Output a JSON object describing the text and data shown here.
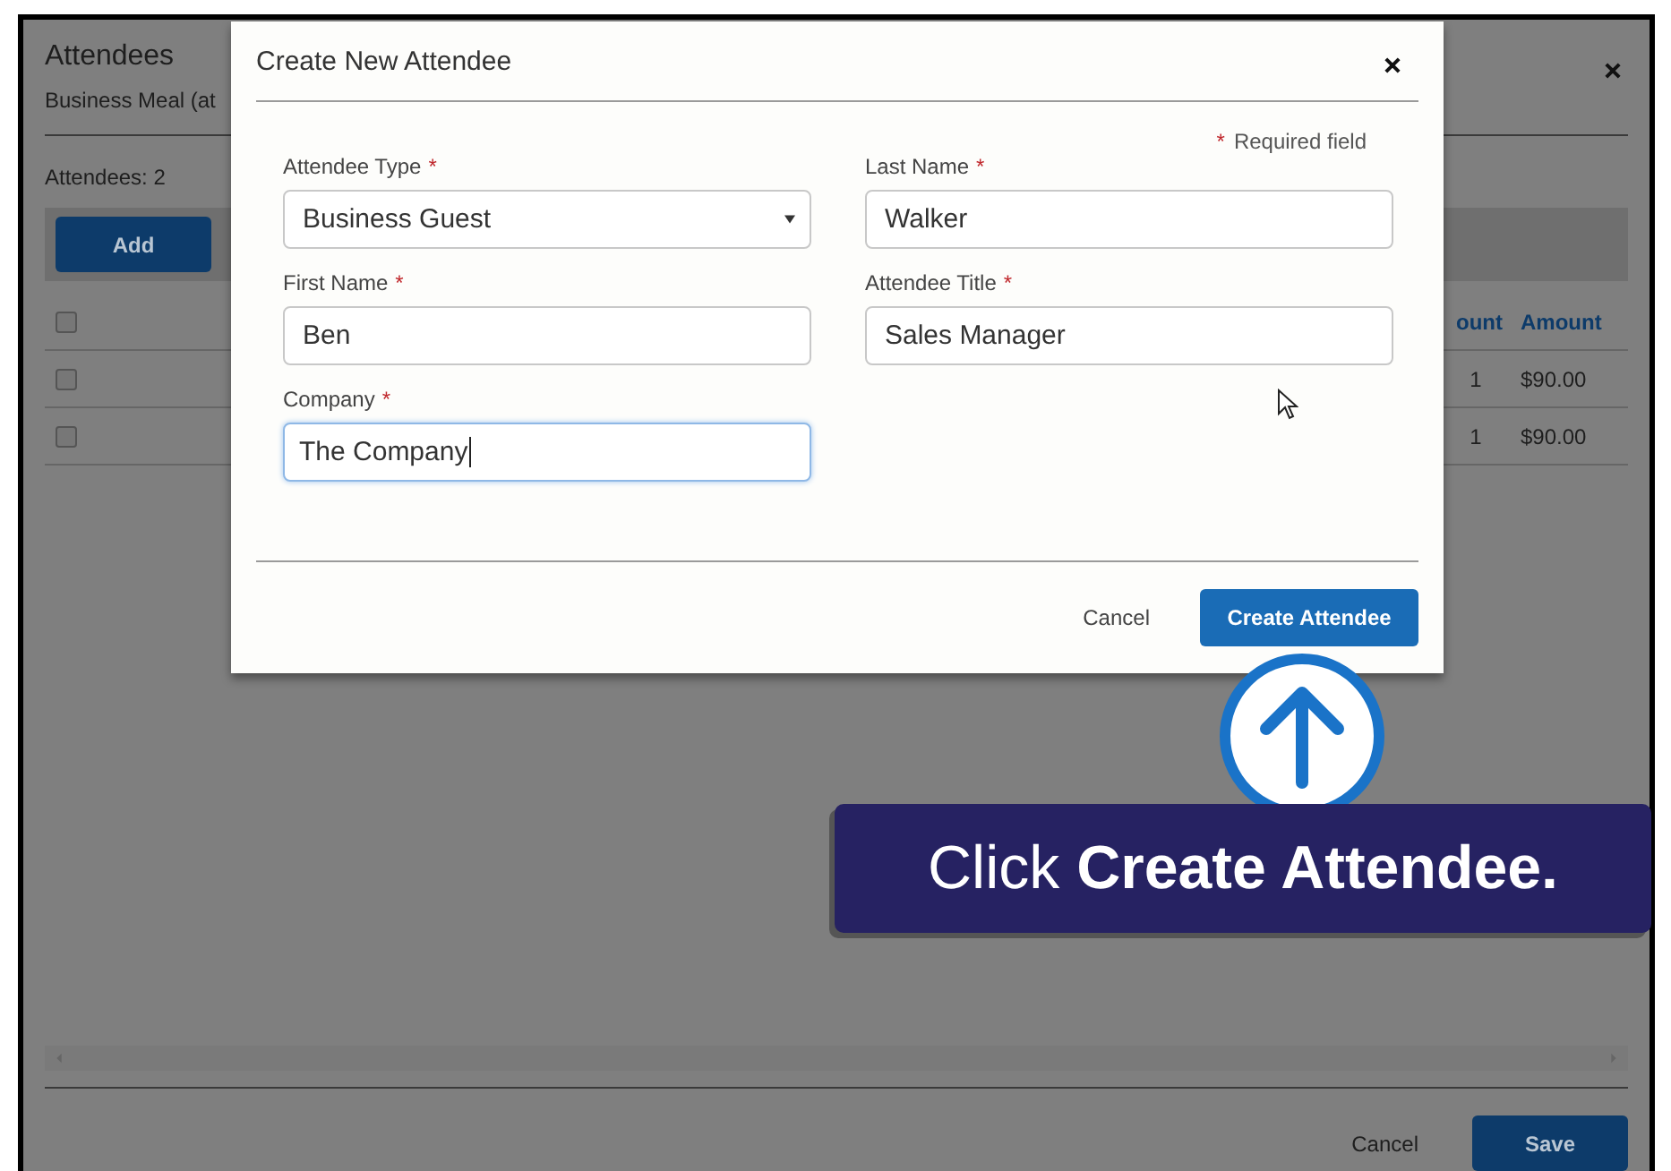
{
  "background": {
    "title": "Attendees",
    "subtitle": "Business Meal (at",
    "count": "Attendees: 2",
    "add_button": "Add",
    "header_checked": false,
    "columns": [
      "ount",
      "Amount"
    ],
    "rows": [
      {
        "checked": false,
        "cells": [
          "1",
          "$90.00"
        ]
      },
      {
        "checked": false,
        "cells": [
          "1",
          "$90.00"
        ]
      }
    ],
    "cancel": "Cancel",
    "save": "Save"
  },
  "dialog": {
    "title": "Create New Attendee",
    "required_note": {
      "mark": "*",
      "text": "Required field"
    },
    "fields": [
      {
        "kind": "select",
        "label": "Attendee Type",
        "mark": "*",
        "value": "Business Guest",
        "focused": false
      },
      {
        "kind": "text",
        "label": "Last Name",
        "mark": "*",
        "value": "Walker",
        "focused": false
      },
      {
        "kind": "text",
        "label": "First Name",
        "mark": "*",
        "value": "Ben",
        "focused": false
      },
      {
        "kind": "text",
        "label": "Attendee Title",
        "mark": "*",
        "value": "Sales Manager",
        "focused": false
      },
      {
        "kind": "text",
        "label": "Company",
        "mark": "*",
        "value": "The Company",
        "focused": true
      }
    ],
    "cancel": "Cancel",
    "create": "Create Attendee"
  },
  "callout": {
    "text": "Click **Create Attendee.**"
  }
}
